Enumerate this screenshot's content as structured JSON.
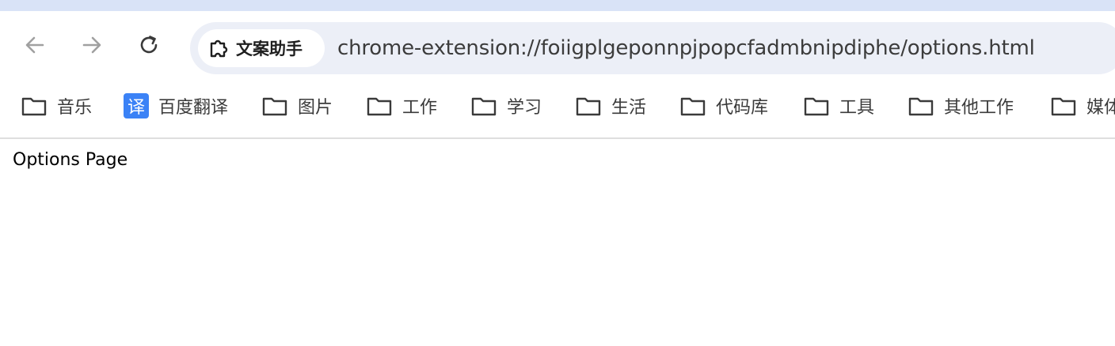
{
  "toolbar": {
    "back_icon": "arrow-left-icon",
    "forward_icon": "arrow-right-icon",
    "reload_icon": "reload-icon"
  },
  "omnibox": {
    "chip_icon": "puzzle-extension-icon",
    "chip_label": "文案助手",
    "url": "chrome-extension://foiigplgeponnpjpopcfadmbnipdiphe/options.html"
  },
  "bookmarks": [
    {
      "label": "音乐",
      "icon": "folder-icon"
    },
    {
      "label": "百度翻译",
      "icon": "translate-icon",
      "icon_glyph": "译",
      "icon_color": "#3b82f6"
    },
    {
      "label": "图片",
      "icon": "folder-icon"
    },
    {
      "label": "工作",
      "icon": "folder-icon"
    },
    {
      "label": "学习",
      "icon": "folder-icon"
    },
    {
      "label": "生活",
      "icon": "folder-icon"
    },
    {
      "label": "代码库",
      "icon": "folder-icon"
    },
    {
      "label": "工具",
      "icon": "folder-icon"
    },
    {
      "label": "其他工作",
      "icon": "folder-icon"
    },
    {
      "label": "媒体",
      "icon": "folder-icon"
    }
  ],
  "page": {
    "text": "Options Page"
  },
  "colors": {
    "top_strip": "#d9e3f7",
    "omnibox_bg": "#eceff7",
    "accent_blue": "#3b82f6"
  }
}
